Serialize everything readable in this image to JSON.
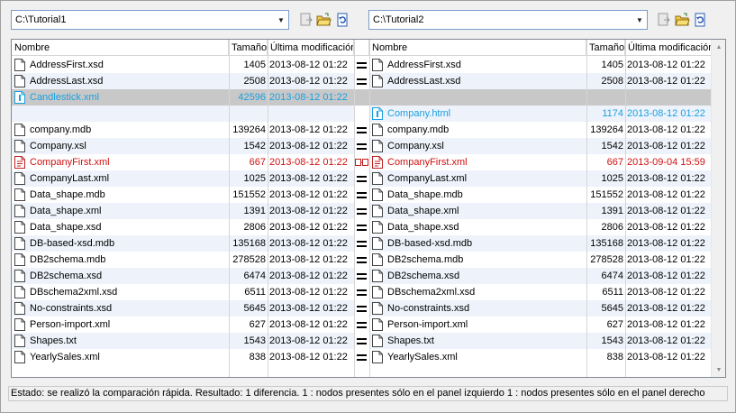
{
  "left_path": "C:\\Tutorial1",
  "right_path": "C:\\Tutorial2",
  "headers": {
    "name": "Nombre",
    "size": "Tamaño",
    "date": "Última modificación"
  },
  "rows": [
    {
      "left": {
        "name": "AddressFirst.xsd",
        "size": "1405",
        "date": "2013-08-12 01:22"
      },
      "mid": "equal",
      "right": {
        "name": "AddressFirst.xsd",
        "size": "1405",
        "date": "2013-08-12 01:22"
      }
    },
    {
      "left": {
        "name": "AddressLast.xsd",
        "size": "2508",
        "date": "2013-08-12 01:22"
      },
      "mid": "equal",
      "right": {
        "name": "AddressLast.xsd",
        "size": "2508",
        "date": "2013-08-12 01:22"
      }
    },
    {
      "left": {
        "name": "Candlestick.xml",
        "size": "42596",
        "date": "2013-08-12 01:22"
      },
      "mid": "none",
      "right": null,
      "state": "left-only"
    },
    {
      "left": null,
      "mid": "none",
      "right": {
        "name": "Company.html",
        "size": "1174",
        "date": "2013-08-12 01:22"
      },
      "state": "right-only"
    },
    {
      "left": {
        "name": "company.mdb",
        "size": "139264",
        "date": "2013-08-12 01:22"
      },
      "mid": "equal",
      "right": {
        "name": "company.mdb",
        "size": "139264",
        "date": "2013-08-12 01:22"
      }
    },
    {
      "left": {
        "name": "Company.xsl",
        "size": "1542",
        "date": "2013-08-12 01:22"
      },
      "mid": "equal",
      "right": {
        "name": "Company.xsl",
        "size": "1542",
        "date": "2013-08-12 01:22"
      }
    },
    {
      "left": {
        "name": "CompanyFirst.xml",
        "size": "667",
        "date": "2013-08-12 01:22"
      },
      "mid": "diff",
      "right": {
        "name": "CompanyFirst.xml",
        "size": "667",
        "date": "2013-09-04 15:59"
      },
      "state": "different"
    },
    {
      "left": {
        "name": "CompanyLast.xml",
        "size": "1025",
        "date": "2013-08-12 01:22"
      },
      "mid": "equal",
      "right": {
        "name": "CompanyLast.xml",
        "size": "1025",
        "date": "2013-08-12 01:22"
      }
    },
    {
      "left": {
        "name": "Data_shape.mdb",
        "size": "151552",
        "date": "2013-08-12 01:22"
      },
      "mid": "equal",
      "right": {
        "name": "Data_shape.mdb",
        "size": "151552",
        "date": "2013-08-12 01:22"
      }
    },
    {
      "left": {
        "name": "Data_shape.xml",
        "size": "1391",
        "date": "2013-08-12 01:22"
      },
      "mid": "equal",
      "right": {
        "name": "Data_shape.xml",
        "size": "1391",
        "date": "2013-08-12 01:22"
      }
    },
    {
      "left": {
        "name": "Data_shape.xsd",
        "size": "2806",
        "date": "2013-08-12 01:22"
      },
      "mid": "equal",
      "right": {
        "name": "Data_shape.xsd",
        "size": "2806",
        "date": "2013-08-12 01:22"
      }
    },
    {
      "left": {
        "name": "DB-based-xsd.mdb",
        "size": "135168",
        "date": "2013-08-12 01:22"
      },
      "mid": "equal",
      "right": {
        "name": "DB-based-xsd.mdb",
        "size": "135168",
        "date": "2013-08-12 01:22"
      }
    },
    {
      "left": {
        "name": "DB2schema.mdb",
        "size": "278528",
        "date": "2013-08-12 01:22"
      },
      "mid": "equal",
      "right": {
        "name": "DB2schema.mdb",
        "size": "278528",
        "date": "2013-08-12 01:22"
      }
    },
    {
      "left": {
        "name": "DB2schema.xsd",
        "size": "6474",
        "date": "2013-08-12 01:22"
      },
      "mid": "equal",
      "right": {
        "name": "DB2schema.xsd",
        "size": "6474",
        "date": "2013-08-12 01:22"
      }
    },
    {
      "left": {
        "name": "DBschema2xml.xsd",
        "size": "6511",
        "date": "2013-08-12 01:22"
      },
      "mid": "equal",
      "right": {
        "name": "DBschema2xml.xsd",
        "size": "6511",
        "date": "2013-08-12 01:22"
      }
    },
    {
      "left": {
        "name": "No-constraints.xsd",
        "size": "5645",
        "date": "2013-08-12 01:22"
      },
      "mid": "equal",
      "right": {
        "name": "No-constraints.xsd",
        "size": "5645",
        "date": "2013-08-12 01:22"
      }
    },
    {
      "left": {
        "name": "Person-import.xml",
        "size": "627",
        "date": "2013-08-12 01:22"
      },
      "mid": "equal",
      "right": {
        "name": "Person-import.xml",
        "size": "627",
        "date": "2013-08-12 01:22"
      }
    },
    {
      "left": {
        "name": "Shapes.txt",
        "size": "1543",
        "date": "2013-08-12 01:22"
      },
      "mid": "equal",
      "right": {
        "name": "Shapes.txt",
        "size": "1543",
        "date": "2013-08-12 01:22"
      }
    },
    {
      "left": {
        "name": "YearlySales.xml",
        "size": "838",
        "date": "2013-08-12 01:22"
      },
      "mid": "equal",
      "right": {
        "name": "YearlySales.xml",
        "size": "838",
        "date": "2013-08-12 01:22"
      }
    }
  ],
  "status": "Estado: se realizó la comparación rápida. Resultado: 1 diferencia. 1 : nodos presentes sólo en el panel izquierdo 1 : nodos presentes sólo en el panel derecho",
  "colors": {
    "left_only": "#1aa0e0",
    "different": "#d01010",
    "selected": "#c8c8c8",
    "alt_row": "#eef3fb"
  }
}
